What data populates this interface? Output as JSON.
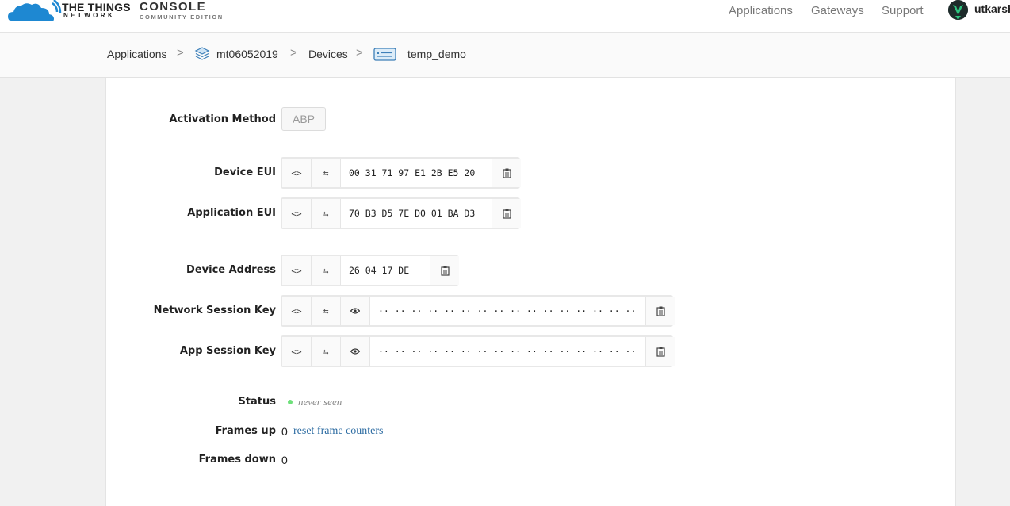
{
  "header": {
    "brand_line1": "THE THINGS",
    "brand_line2": "NETWORK",
    "console_title": "CONSOLE",
    "console_subtitle": "COMMUNITY EDITION",
    "nav": [
      "Applications",
      "Gateways",
      "Support"
    ],
    "username": "utkarsh"
  },
  "breadcrumb": {
    "items": [
      "Applications",
      "mt06052019",
      "Devices",
      "temp_demo"
    ],
    "separator": ">"
  },
  "device": {
    "activation_method": {
      "label": "Activation Method",
      "value": "ABP"
    },
    "device_eui": {
      "label": "Device EUI",
      "value": "00 31 71 97 E1 2B E5 20"
    },
    "application_eui": {
      "label": "Application EUI",
      "value": "70 B3 D5 7E D0 01 BA D3"
    },
    "device_address": {
      "label": "Device Address",
      "value": "26 04 17 DE"
    },
    "network_session_key": {
      "label": "Network Session Key",
      "value": "·· ·· ·· ·· ·· ·· ·· ·· ·· ·· ·· ·· ·· ·· ·· ··"
    },
    "app_session_key": {
      "label": "App Session Key",
      "value": "·· ·· ·· ·· ·· ·· ·· ·· ·· ·· ·· ·· ·· ·· ·· ··"
    },
    "status": {
      "label": "Status",
      "value": "never seen",
      "color": "#6ee07a"
    },
    "frames_up": {
      "label": "Frames up",
      "value": "0",
      "link": "reset frame counters"
    },
    "frames_down": {
      "label": "Frames down",
      "value": "0"
    }
  },
  "icons": {
    "format_toggle": "code-brackets-icon",
    "byte_order": "swap-arrows-icon",
    "reveal": "eye-icon",
    "copy": "clipboard-icon"
  },
  "colors": {
    "brand_blue": "#1e88d2",
    "link": "#2d6ca2"
  }
}
